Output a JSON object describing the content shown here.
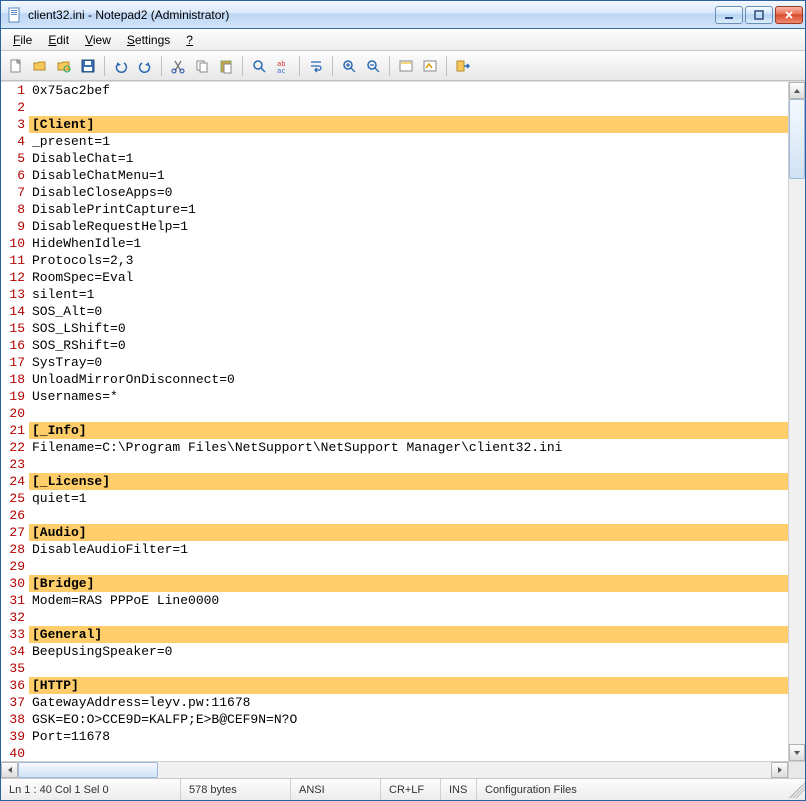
{
  "window": {
    "title": "client32.ini - Notepad2 (Administrator)"
  },
  "menus": {
    "file": "File",
    "edit": "Edit",
    "view": "View",
    "settings": "Settings",
    "help": "?"
  },
  "toolbar_icons": [
    "new-file-icon",
    "open-file-icon",
    "browse-icon",
    "save-icon",
    "undo-icon",
    "redo-icon",
    "cut-icon",
    "copy-icon",
    "paste-icon",
    "find-icon",
    "replace-icon",
    "word-wrap-icon",
    "zoom-in-icon",
    "zoom-out-icon",
    "scheme-icon",
    "customize-icon",
    "exit-icon"
  ],
  "editor": {
    "lines": [
      {
        "n": 1,
        "t": "0x75ac2bef",
        "s": false
      },
      {
        "n": 2,
        "t": "",
        "s": false
      },
      {
        "n": 3,
        "t": "[Client]",
        "s": true
      },
      {
        "n": 4,
        "t": "_present=1",
        "s": false
      },
      {
        "n": 5,
        "t": "DisableChat=1",
        "s": false
      },
      {
        "n": 6,
        "t": "DisableChatMenu=1",
        "s": false
      },
      {
        "n": 7,
        "t": "DisableCloseApps=0",
        "s": false
      },
      {
        "n": 8,
        "t": "DisablePrintCapture=1",
        "s": false
      },
      {
        "n": 9,
        "t": "DisableRequestHelp=1",
        "s": false
      },
      {
        "n": 10,
        "t": "HideWhenIdle=1",
        "s": false
      },
      {
        "n": 11,
        "t": "Protocols=2,3",
        "s": false
      },
      {
        "n": 12,
        "t": "RoomSpec=Eval",
        "s": false
      },
      {
        "n": 13,
        "t": "silent=1",
        "s": false
      },
      {
        "n": 14,
        "t": "SOS_Alt=0",
        "s": false
      },
      {
        "n": 15,
        "t": "SOS_LShift=0",
        "s": false
      },
      {
        "n": 16,
        "t": "SOS_RShift=0",
        "s": false
      },
      {
        "n": 17,
        "t": "SysTray=0",
        "s": false
      },
      {
        "n": 18,
        "t": "UnloadMirrorOnDisconnect=0",
        "s": false
      },
      {
        "n": 19,
        "t": "Usernames=*",
        "s": false
      },
      {
        "n": 20,
        "t": "",
        "s": false
      },
      {
        "n": 21,
        "t": "[_Info]",
        "s": true
      },
      {
        "n": 22,
        "t": "Filename=C:\\Program Files\\NetSupport\\NetSupport Manager\\client32.ini",
        "s": false
      },
      {
        "n": 23,
        "t": "",
        "s": false
      },
      {
        "n": 24,
        "t": "[_License]",
        "s": true
      },
      {
        "n": 25,
        "t": "quiet=1",
        "s": false
      },
      {
        "n": 26,
        "t": "",
        "s": false
      },
      {
        "n": 27,
        "t": "[Audio]",
        "s": true
      },
      {
        "n": 28,
        "t": "DisableAudioFilter=1",
        "s": false
      },
      {
        "n": 29,
        "t": "",
        "s": false
      },
      {
        "n": 30,
        "t": "[Bridge]",
        "s": true
      },
      {
        "n": 31,
        "t": "Modem=RAS PPPoE Line0000",
        "s": false
      },
      {
        "n": 32,
        "t": "",
        "s": false
      },
      {
        "n": 33,
        "t": "[General]",
        "s": true
      },
      {
        "n": 34,
        "t": "BeepUsingSpeaker=0",
        "s": false
      },
      {
        "n": 35,
        "t": "",
        "s": false
      },
      {
        "n": 36,
        "t": "[HTTP]",
        "s": true
      },
      {
        "n": 37,
        "t": "GatewayAddress=leyv.pw:11678",
        "s": false
      },
      {
        "n": 38,
        "t": "GSK=EO:O>CCE9D=KALFP;E>B@CEF9N=N?O",
        "s": false
      },
      {
        "n": 39,
        "t": "Port=11678",
        "s": false
      },
      {
        "n": 40,
        "t": "",
        "s": false
      }
    ]
  },
  "status": {
    "pos": "Ln 1 : 40   Col 1   Sel 0",
    "bytes": "578 bytes",
    "encoding": "ANSI",
    "lineend": "CR+LF",
    "ovr": "INS",
    "lexer": "Configuration Files"
  }
}
